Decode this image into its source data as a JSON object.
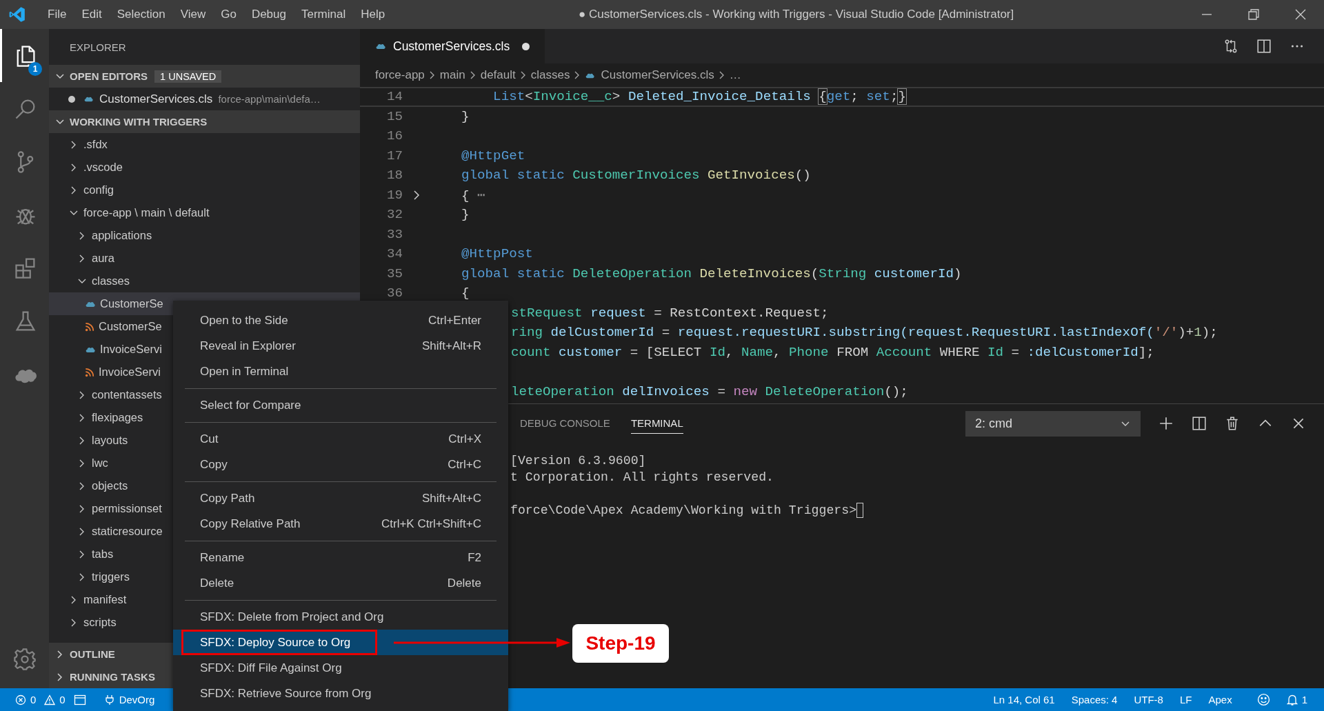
{
  "title_bar": {
    "menus": [
      "File",
      "Edit",
      "Selection",
      "View",
      "Go",
      "Debug",
      "Terminal",
      "Help"
    ],
    "title": "● CustomerServices.cls - Working with Triggers - Visual Studio Code [Administrator]"
  },
  "activity_bar": {
    "items": [
      {
        "kind": "explorer",
        "selected": true,
        "badge": "1"
      },
      {
        "kind": "search",
        "selected": false
      },
      {
        "kind": "scm",
        "selected": false
      },
      {
        "kind": "debug",
        "selected": false
      },
      {
        "kind": "extensions",
        "selected": false
      },
      {
        "kind": "test",
        "selected": false
      },
      {
        "kind": "cloud",
        "selected": false
      }
    ]
  },
  "sidebar": {
    "title": "EXPLORER",
    "open_editors": {
      "label": "OPEN EDITORS",
      "badge": "1 UNSAVED",
      "expanded": true,
      "files": [
        {
          "name": "CustomerServices.cls",
          "path": "force-app\\main\\defa…",
          "dirty": true
        }
      ]
    },
    "folder": {
      "label": "WORKING WITH TRIGGERS",
      "expanded": true,
      "tree": [
        {
          "label": ".sfdx",
          "kind": "folder",
          "expanded": false,
          "selected": false
        },
        {
          "label": ".vscode",
          "kind": "folder",
          "expanded": false,
          "selected": false
        },
        {
          "label": "config",
          "kind": "folder",
          "expanded": false,
          "selected": false
        },
        {
          "label": "force-app \\ main \\ default",
          "kind": "folder",
          "expanded": true,
          "selected": false,
          "children": [
            {
              "label": "applications",
              "kind": "folder",
              "expanded": false,
              "selected": false
            },
            {
              "label": "aura",
              "kind": "folder",
              "expanded": false,
              "selected": false
            },
            {
              "label": "classes",
              "kind": "folder",
              "expanded": true,
              "selected": false,
              "children": [
                {
                  "label": "CustomerSe",
                  "kind": "apex",
                  "selected": true
                },
                {
                  "label": "CustomerSe",
                  "kind": "meta",
                  "selected": false
                },
                {
                  "label": "InvoiceServi",
                  "kind": "apex",
                  "selected": false
                },
                {
                  "label": "InvoiceServi",
                  "kind": "meta",
                  "selected": false
                }
              ]
            },
            {
              "label": "contentassets",
              "kind": "folder",
              "expanded": false,
              "selected": false
            },
            {
              "label": "flexipages",
              "kind": "folder",
              "expanded": false,
              "selected": false
            },
            {
              "label": "layouts",
              "kind": "folder",
              "expanded": false,
              "selected": false
            },
            {
              "label": "lwc",
              "kind": "folder",
              "expanded": false,
              "selected": false
            },
            {
              "label": "objects",
              "kind": "folder",
              "expanded": false,
              "selected": false
            },
            {
              "label": "permissionset",
              "kind": "folder",
              "expanded": false,
              "selected": false
            },
            {
              "label": "staticresource",
              "kind": "folder",
              "expanded": false,
              "selected": false
            },
            {
              "label": "tabs",
              "kind": "folder",
              "expanded": false,
              "selected": false
            },
            {
              "label": "triggers",
              "kind": "folder",
              "expanded": false,
              "selected": false
            }
          ]
        },
        {
          "label": "manifest",
          "kind": "folder",
          "expanded": false,
          "selected": false
        },
        {
          "label": "scripts",
          "kind": "folder",
          "expanded": false,
          "selected": false
        }
      ]
    },
    "collapsed_sections": [
      {
        "label": "OUTLINE",
        "expanded": false
      },
      {
        "label": "RUNNING TASKS",
        "expanded": false
      }
    ]
  },
  "editor": {
    "tabs": [
      {
        "name": "CustomerServices.cls",
        "dirty": true,
        "selected": true
      }
    ],
    "breadcrumb": [
      {
        "label": "force-app",
        "kind": "folder"
      },
      {
        "label": "main",
        "kind": "folder"
      },
      {
        "label": "default",
        "kind": "folder"
      },
      {
        "label": "classes",
        "kind": "folder"
      },
      {
        "label": "CustomerServices.cls",
        "kind": "file"
      },
      {
        "label": "…",
        "kind": "more"
      }
    ],
    "lines": [
      {
        "number": "14",
        "current": true,
        "tokens": [
          {
            "kind": "kw",
            "text": "        List"
          },
          {
            "kind": "plain",
            "text": "<"
          },
          {
            "kind": "type",
            "text": "Invoice__c"
          },
          {
            "kind": "plain",
            "text": "> "
          },
          {
            "kind": "var",
            "text": "Deleted_Invoice_Details "
          },
          {
            "kind": "bracket",
            "text": "{"
          },
          {
            "kind": "kw",
            "text": "get"
          },
          {
            "kind": "plain",
            "text": "; "
          },
          {
            "kind": "kw",
            "text": "set"
          },
          {
            "kind": "plain",
            "text": ";"
          },
          {
            "kind": "bracket",
            "text": "}"
          }
        ]
      },
      {
        "number": "15",
        "tokens": [
          {
            "kind": "plain",
            "text": "    }"
          }
        ]
      },
      {
        "number": "16"
      },
      {
        "number": "17",
        "tokens": [
          {
            "kind": "anno",
            "text": "    @HttpGet"
          }
        ]
      },
      {
        "number": "18",
        "tokens": [
          {
            "kind": "kw",
            "text": "    global static "
          },
          {
            "kind": "type",
            "text": "CustomerInvoices "
          },
          {
            "kind": "fn",
            "text": "GetInvoices"
          },
          {
            "kind": "plain",
            "text": "()"
          }
        ]
      },
      {
        "number": "19",
        "folded": true,
        "tokens": [
          {
            "kind": "plain",
            "text": "    { "
          },
          {
            "kind": "fold",
            "text": "⋯"
          }
        ]
      },
      {
        "number": "32",
        "tokens": [
          {
            "kind": "plain",
            "text": "    }"
          }
        ]
      },
      {
        "number": "33"
      },
      {
        "number": "34",
        "tokens": [
          {
            "kind": "anno",
            "text": "    @HttpPost"
          }
        ]
      },
      {
        "number": "35",
        "tokens": [
          {
            "kind": "kw",
            "text": "    global static "
          },
          {
            "kind": "type",
            "text": "DeleteOperation "
          },
          {
            "kind": "fn",
            "text": "DeleteInvoices"
          },
          {
            "kind": "plain",
            "text": "("
          },
          {
            "kind": "type",
            "text": "String "
          },
          {
            "kind": "var",
            "text": "customerId"
          },
          {
            "kind": "plain",
            "text": ")"
          }
        ]
      },
      {
        "number": "36",
        "tokens": [
          {
            "kind": "plain",
            "text": "    {"
          }
        ]
      },
      {
        "covered": true,
        "tokens": [
          {
            "kind": "type",
            "text": "stRequest "
          },
          {
            "kind": "var",
            "text": "request"
          },
          {
            "kind": "plain",
            "text": " = RestContext.Request;"
          }
        ]
      },
      {
        "covered": true,
        "tokens": [
          {
            "kind": "type",
            "text": "ring "
          },
          {
            "kind": "var",
            "text": "delCustomerId"
          },
          {
            "kind": "plain",
            "text": " = "
          },
          {
            "kind": "var",
            "text": "request.requestURI.substring(request.RequestURI.lastIndexOf("
          },
          {
            "kind": "str",
            "text": "'/'"
          },
          {
            "kind": "plain",
            "text": ")+"
          },
          {
            "kind": "num",
            "text": "1"
          },
          {
            "kind": "plain",
            "text": ");"
          }
        ]
      },
      {
        "covered": true,
        "tokens": [
          {
            "kind": "type",
            "text": "count "
          },
          {
            "kind": "var",
            "text": "customer"
          },
          {
            "kind": "plain",
            "text": " = [SELECT "
          },
          {
            "kind": "type",
            "text": "Id"
          },
          {
            "kind": "plain",
            "text": ", "
          },
          {
            "kind": "type",
            "text": "Name"
          },
          {
            "kind": "plain",
            "text": ", "
          },
          {
            "kind": "type",
            "text": "Phone "
          },
          {
            "kind": "plain",
            "text": "FROM "
          },
          {
            "kind": "type",
            "text": "Account "
          },
          {
            "kind": "plain",
            "text": "WHERE "
          },
          {
            "kind": "type",
            "text": "Id "
          },
          {
            "kind": "plain",
            "text": "= "
          },
          {
            "kind": "var",
            "text": ":delCustomerId"
          },
          {
            "kind": "plain",
            "text": "];"
          }
        ]
      },
      {
        "covered": true,
        "blank_before": true,
        "tokens": [
          {
            "kind": "type",
            "text": "leteOperation "
          },
          {
            "kind": "var",
            "text": "delInvoices"
          },
          {
            "kind": "plain",
            "text": " = "
          },
          {
            "kind": "ctl",
            "text": "new "
          },
          {
            "kind": "type",
            "text": "DeleteOperation"
          },
          {
            "kind": "plain",
            "text": "();"
          }
        ]
      }
    ]
  },
  "panel": {
    "tabs": [
      {
        "label": "DEBUG CONSOLE",
        "selected": false
      },
      {
        "label": "TERMINAL",
        "selected": true
      }
    ],
    "terminal_picker": "2: cmd",
    "lines": [
      {
        "text": "[Version 6.3.9600]"
      },
      {
        "text": "t Corporation. All rights reserved."
      },
      {
        "text": "force\\Code\\Apex Academy\\Working with Triggers>",
        "blank_before": true,
        "cursor": true
      }
    ]
  },
  "context_menu": {
    "groups": [
      [
        {
          "label": "Open to the Side",
          "shortcut": "Ctrl+Enter",
          "selected": false
        },
        {
          "label": "Reveal in Explorer",
          "shortcut": "Shift+Alt+R",
          "selected": false
        },
        {
          "label": "Open in Terminal",
          "selected": false
        }
      ],
      [
        {
          "label": "Select for Compare",
          "selected": false
        }
      ],
      [
        {
          "label": "Cut",
          "shortcut": "Ctrl+X",
          "selected": false
        },
        {
          "label": "Copy",
          "shortcut": "Ctrl+C",
          "selected": false
        }
      ],
      [
        {
          "label": "Copy Path",
          "shortcut": "Shift+Alt+C",
          "selected": false
        },
        {
          "label": "Copy Relative Path",
          "shortcut": "Ctrl+K Ctrl+Shift+C",
          "selected": false
        }
      ],
      [
        {
          "label": "Rename",
          "shortcut": "F2",
          "selected": false
        },
        {
          "label": "Delete",
          "shortcut": "Delete",
          "selected": false
        }
      ],
      [
        {
          "label": "SFDX: Delete from Project and Org",
          "selected": false
        },
        {
          "label": "SFDX: Deploy Source to Org",
          "selected": true
        },
        {
          "label": "SFDX: Diff File Against Org",
          "selected": false
        },
        {
          "label": "SFDX: Retrieve Source from Org",
          "selected": false
        }
      ]
    ]
  },
  "annotation": {
    "label": "Step-19"
  },
  "status_bar": {
    "errors": "0",
    "warnings": "0",
    "org": "DevOrg",
    "right": [
      {
        "kind": "text",
        "text": "Ln 14, Col 61"
      },
      {
        "kind": "text",
        "text": "Spaces: 4"
      },
      {
        "kind": "text",
        "text": "UTF-8"
      },
      {
        "kind": "text",
        "text": "LF"
      },
      {
        "kind": "text",
        "text": "Apex"
      },
      {
        "kind": "feedback"
      },
      {
        "kind": "notifications",
        "text": "1"
      }
    ]
  }
}
